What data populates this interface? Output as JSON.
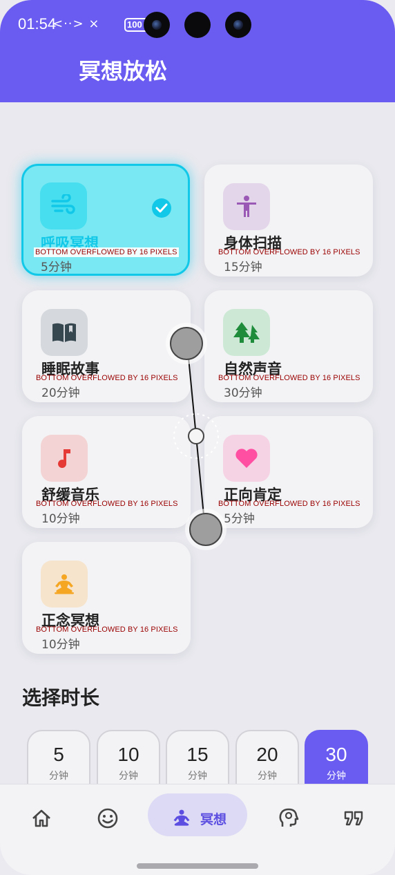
{
  "status_bar": {
    "time": "01:54",
    "icons_text": "<··> ×",
    "battery": "100"
  },
  "header": {
    "title": "冥想放松"
  },
  "meditations": [
    {
      "title": "呼吸冥想",
      "duration": "5分钟",
      "icon": "wind-icon",
      "icon_color": "#12c8e8",
      "tile_color": "#47dff0",
      "selected": true,
      "overflow": "BOTTOM OVERFLOWED BY 16 PIXELS"
    },
    {
      "title": "身体扫描",
      "duration": "15分钟",
      "icon": "body-scan-icon",
      "icon_color": "#9b59b6",
      "tile_color": "#e4d6ea",
      "selected": false,
      "overflow": "BOTTOM OVERFLOWED BY 16 PIXELS"
    },
    {
      "title": "睡眠故事",
      "duration": "20分钟",
      "icon": "book-icon",
      "icon_color": "#37474f",
      "tile_color": "#d5d9dd",
      "selected": false,
      "overflow": "BOTTOM OVERFLOWED BY 16 PIXELS"
    },
    {
      "title": "自然声音",
      "duration": "30分钟",
      "icon": "forest-icon",
      "icon_color": "#1e8c3a",
      "tile_color": "#cde9d6",
      "selected": false,
      "overflow": "BOTTOM OVERFLOWED BY 16 PIXELS"
    },
    {
      "title": "舒缓音乐",
      "duration": "10分钟",
      "icon": "music-note-icon",
      "icon_color": "#e53935",
      "tile_color": "#f3d3d3",
      "selected": false,
      "overflow": "BOTTOM OVERFLOWED BY 16 PIXELS"
    },
    {
      "title": "正向肯定",
      "duration": "5分钟",
      "icon": "heart-icon",
      "icon_color": "#ff4fa3",
      "tile_color": "#f6d3e4",
      "selected": false,
      "overflow": "BOTTOM OVERFLOWED BY 16 PIXELS"
    },
    {
      "title": "正念冥想",
      "duration": "10分钟",
      "icon": "meditation-icon",
      "icon_color": "#f5a623",
      "tile_color": "#f6e4cd",
      "selected": false,
      "overflow": "BOTTOM OVERFLOWED BY 16 PIXELS"
    }
  ],
  "duration_section": {
    "title": "选择时长",
    "unit": "分钟",
    "options": [
      "5",
      "10",
      "15",
      "20",
      "30"
    ],
    "selected": "30"
  },
  "bottom_nav": {
    "items": [
      {
        "icon": "home-icon",
        "label": ""
      },
      {
        "icon": "mood-icon",
        "label": ""
      },
      {
        "icon": "meditation-icon",
        "label": "冥想",
        "active": true
      },
      {
        "icon": "psychology-icon",
        "label": ""
      },
      {
        "icon": "quote-icon",
        "label": ""
      }
    ]
  },
  "colors": {
    "primary": "#6a5cf0",
    "accent": "#12c8e8",
    "overflow_text": "#9a0000"
  }
}
